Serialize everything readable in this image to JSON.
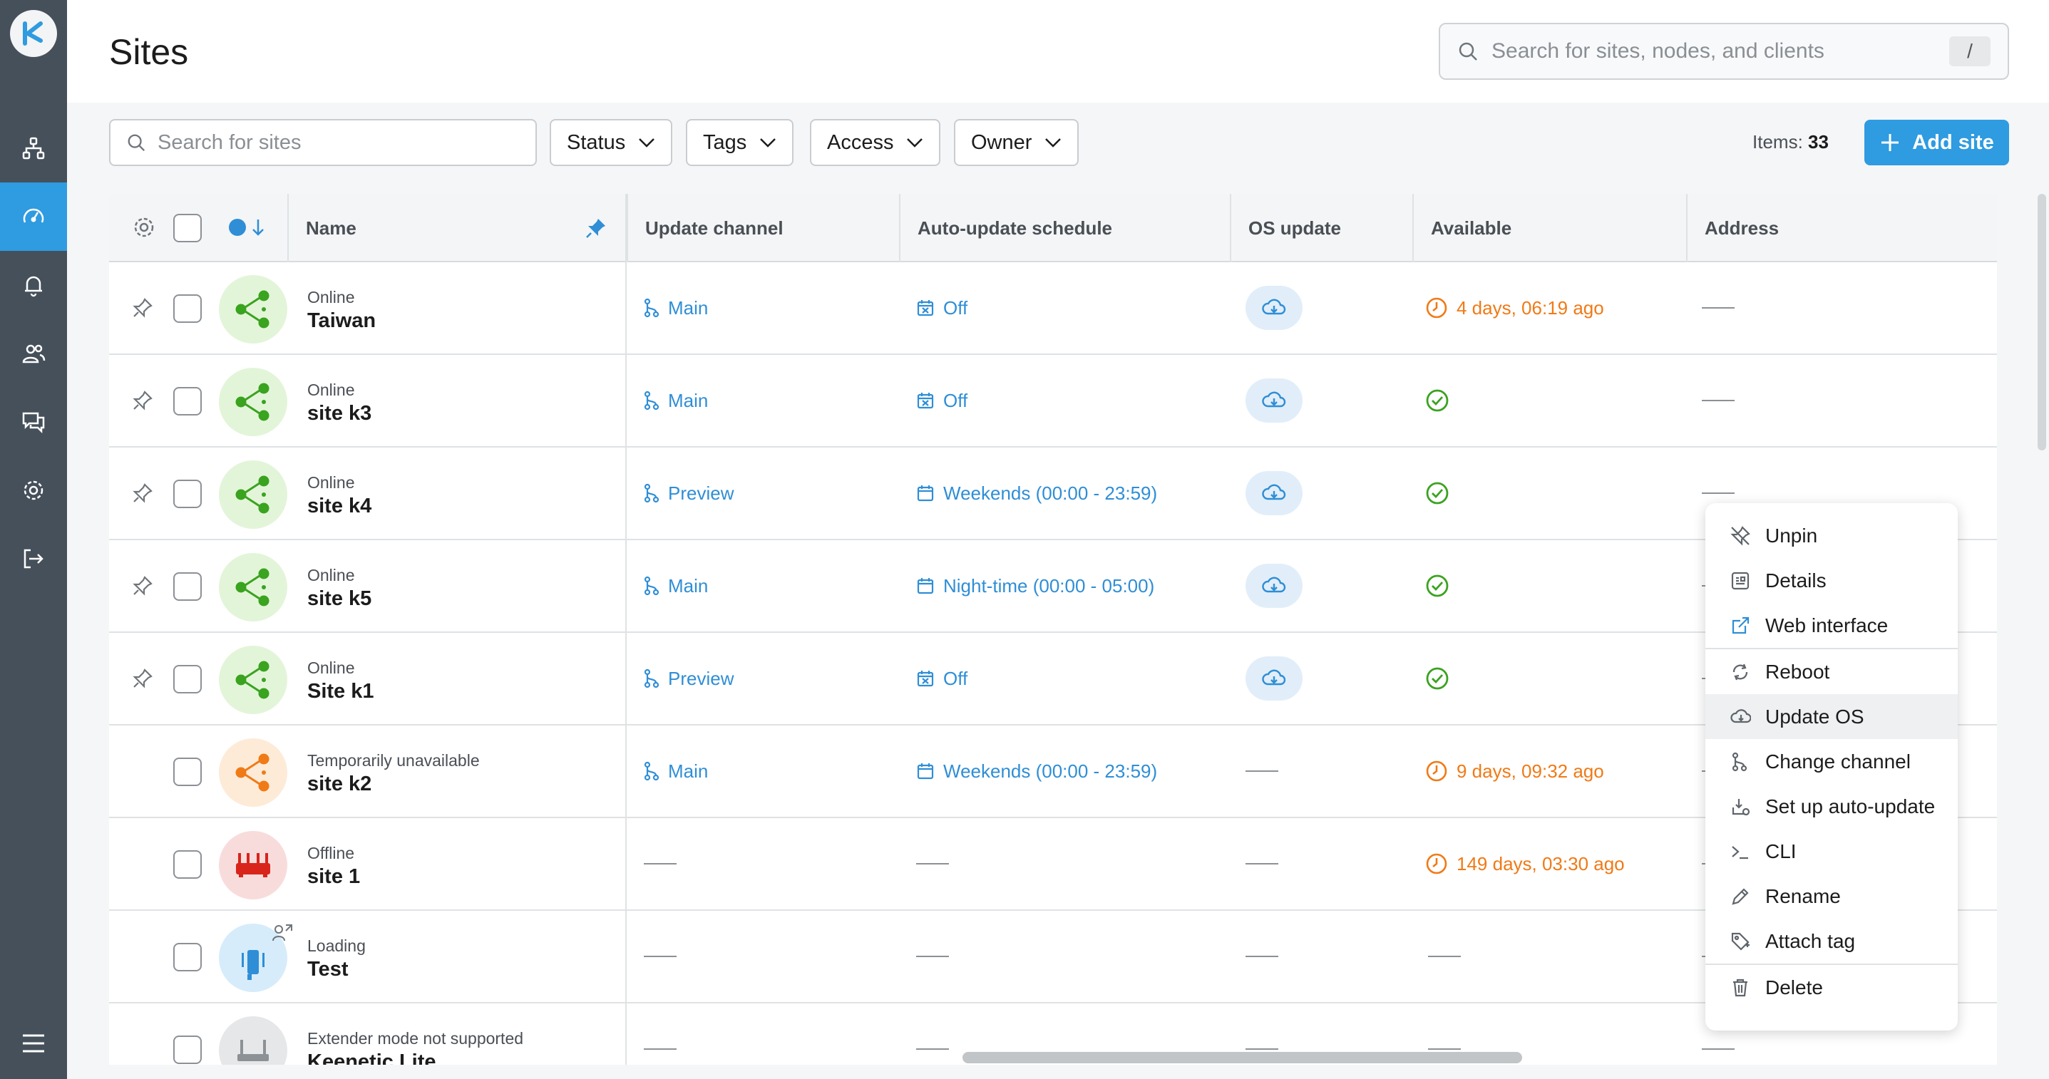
{
  "page": {
    "title": "Sites"
  },
  "global_search": {
    "placeholder": "Search for sites, nodes, and clients",
    "shortcut": "/"
  },
  "toolbar": {
    "search_placeholder": "Search for sites",
    "filters": [
      "Status",
      "Tags",
      "Access",
      "Owner"
    ],
    "items_label": "Items:",
    "items_count": "33",
    "add_site_label": "Add site"
  },
  "table": {
    "columns": [
      "Name",
      "Update channel",
      "Auto-update schedule",
      "OS update",
      "Available",
      "Address"
    ],
    "rows": [
      {
        "status": "Online",
        "name": "Taiwan",
        "channel": "Main",
        "schedule": "Off",
        "os_update": true,
        "available": "4 days, 06:19 ago",
        "available_type": "warn",
        "pinned": true,
        "avatar": "online"
      },
      {
        "status": "Online",
        "name": "site k3",
        "channel": "Main",
        "schedule": "Off",
        "os_update": true,
        "available": "",
        "available_type": "ok",
        "pinned": true,
        "avatar": "online"
      },
      {
        "status": "Online",
        "name": "site k4",
        "channel": "Preview",
        "schedule": "Weekends (00:00 - 23:59)",
        "os_update": true,
        "available": "",
        "available_type": "ok",
        "pinned": true,
        "avatar": "online"
      },
      {
        "status": "Online",
        "name": "site k5",
        "channel": "Main",
        "schedule": "Night-time (00:00 - 05:00)",
        "os_update": true,
        "available": "",
        "available_type": "ok",
        "pinned": true,
        "avatar": "online"
      },
      {
        "status": "Online",
        "name": "Site k1",
        "channel": "Preview",
        "schedule": "Off",
        "os_update": true,
        "available": "",
        "available_type": "ok",
        "pinned": true,
        "avatar": "online"
      },
      {
        "status": "Temporarily unavailable",
        "name": "site k2",
        "channel": "Main",
        "schedule": "Weekends (00:00 - 23:59)",
        "os_update": false,
        "available": "9 days, 09:32 ago",
        "available_type": "warn",
        "pinned": false,
        "avatar": "temp"
      },
      {
        "status": "Offline",
        "name": "site 1",
        "channel": "",
        "schedule": "",
        "os_update": false,
        "available": "149 days, 03:30 ago",
        "available_type": "warn",
        "pinned": false,
        "avatar": "offline"
      },
      {
        "status": "Loading",
        "name": "Test",
        "channel": "",
        "schedule": "",
        "os_update": false,
        "available": "",
        "available_type": "none",
        "pinned": false,
        "avatar": "loading"
      },
      {
        "status": "Extender mode not supported",
        "name": "Keenetic Lite",
        "channel": "",
        "schedule": "",
        "os_update": false,
        "available": "",
        "available_type": "none",
        "pinned": false,
        "avatar": "extender"
      }
    ]
  },
  "context_menu": {
    "groups": [
      [
        {
          "label": "Unpin",
          "icon": "unpin-icon"
        },
        {
          "label": "Details",
          "icon": "details-icon"
        },
        {
          "label": "Web interface",
          "icon": "external-link-icon"
        }
      ],
      [
        {
          "label": "Reboot",
          "icon": "reboot-icon"
        },
        {
          "label": "Update OS",
          "icon": "cloud-download-icon"
        },
        {
          "label": "Change channel",
          "icon": "branch-icon"
        },
        {
          "label": "Set up auto-update",
          "icon": "auto-update-icon"
        },
        {
          "label": "CLI",
          "icon": "terminal-icon"
        },
        {
          "label": "Rename",
          "icon": "pencil-icon"
        },
        {
          "label": "Attach tag",
          "icon": "tag-icon"
        }
      ],
      [
        {
          "label": "Delete",
          "icon": "trash-icon"
        }
      ]
    ],
    "highlighted": "Update OS"
  },
  "colors": {
    "accent": "#2f9be0",
    "sidebar": "#46505b",
    "online": "#3aa31f",
    "warn": "#f07a16",
    "offline": "#d9241c"
  }
}
